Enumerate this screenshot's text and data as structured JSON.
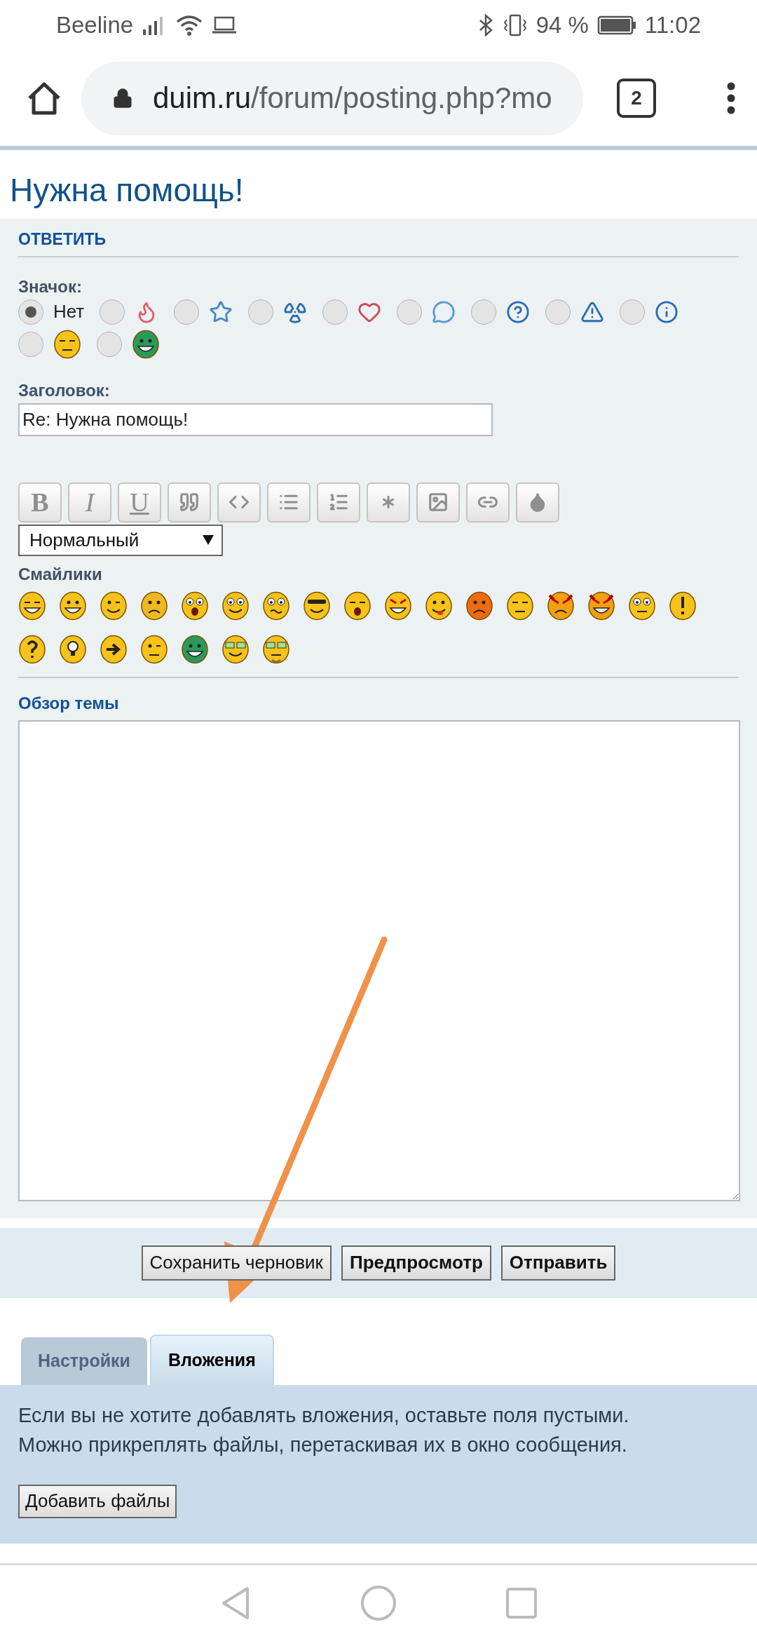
{
  "status_bar": {
    "carrier": "Beeline",
    "battery": "94 %",
    "time": "11:02"
  },
  "browser": {
    "url_domain": "duim.ru",
    "url_path": "/forum/posting.php?mo",
    "tab_count": "2"
  },
  "page_title": "Нужна помощь!",
  "form": {
    "section_title": "ОТВЕТИТЬ",
    "icon_label": "Значок:",
    "icons": [
      {
        "kind": "none",
        "label": "Нет",
        "selected": true
      },
      {
        "kind": "fire",
        "selected": false
      },
      {
        "kind": "star",
        "selected": false
      },
      {
        "kind": "radiation",
        "selected": false
      },
      {
        "kind": "heart",
        "selected": false
      },
      {
        "kind": "bubble",
        "selected": false
      },
      {
        "kind": "question",
        "selected": false
      },
      {
        "kind": "warning",
        "selected": false
      },
      {
        "kind": "info",
        "selected": false
      },
      {
        "kind": "sleepy",
        "selected": false
      },
      {
        "kind": "grin",
        "selected": false
      }
    ],
    "subject_label": "Заголовок:",
    "subject_value": "Re: Нужна помощь!",
    "toolbar": [
      {
        "kind": "bold",
        "label": "B"
      },
      {
        "kind": "italic",
        "label": "I"
      },
      {
        "kind": "underline",
        "label": "U"
      },
      {
        "kind": "quote"
      },
      {
        "kind": "code"
      },
      {
        "kind": "list"
      },
      {
        "kind": "numbered-list"
      },
      {
        "kind": "list-item"
      },
      {
        "kind": "image"
      },
      {
        "kind": "link"
      },
      {
        "kind": "color"
      }
    ],
    "font_size": "Нормальный",
    "smilies_label": "Смайлики",
    "smilies": [
      {
        "kind": "laugh"
      },
      {
        "kind": "smile"
      },
      {
        "kind": "wink"
      },
      {
        "kind": "sad"
      },
      {
        "kind": "shock"
      },
      {
        "kind": "geek"
      },
      {
        "kind": "confused"
      },
      {
        "kind": "cool"
      },
      {
        "kind": "lol"
      },
      {
        "kind": "mad"
      },
      {
        "kind": "razz"
      },
      {
        "kind": "red"
      },
      {
        "kind": "neutral"
      },
      {
        "kind": "evil"
      },
      {
        "kind": "twisted"
      },
      {
        "kind": "rolleyes"
      },
      {
        "kind": "exclaim"
      },
      {
        "kind": "question"
      },
      {
        "kind": "idea"
      },
      {
        "kind": "arrow"
      },
      {
        "kind": "think"
      },
      {
        "kind": "green-grin"
      },
      {
        "kind": "glasses"
      },
      {
        "kind": "glasses-beard"
      }
    ],
    "preview_label": "Обзор темы"
  },
  "buttons": [
    {
      "label": "Сохранить черновик",
      "kind": "default"
    },
    {
      "label": "Предпросмотр",
      "kind": "primary"
    },
    {
      "label": "Отправить",
      "kind": "primary"
    }
  ],
  "tabs": [
    {
      "label": "Настройки",
      "selected": false
    },
    {
      "label": "Вложения",
      "selected": true
    }
  ],
  "attachments": {
    "lines": [
      "Если вы не хотите добавлять вложения, оставьте поля пустыми.",
      "Можно прикреплять файлы, перетаскивая их в окно сообщения."
    ],
    "add_button": "Добавить файлы"
  },
  "annotations": [
    {
      "kind": "arrow"
    }
  ]
}
